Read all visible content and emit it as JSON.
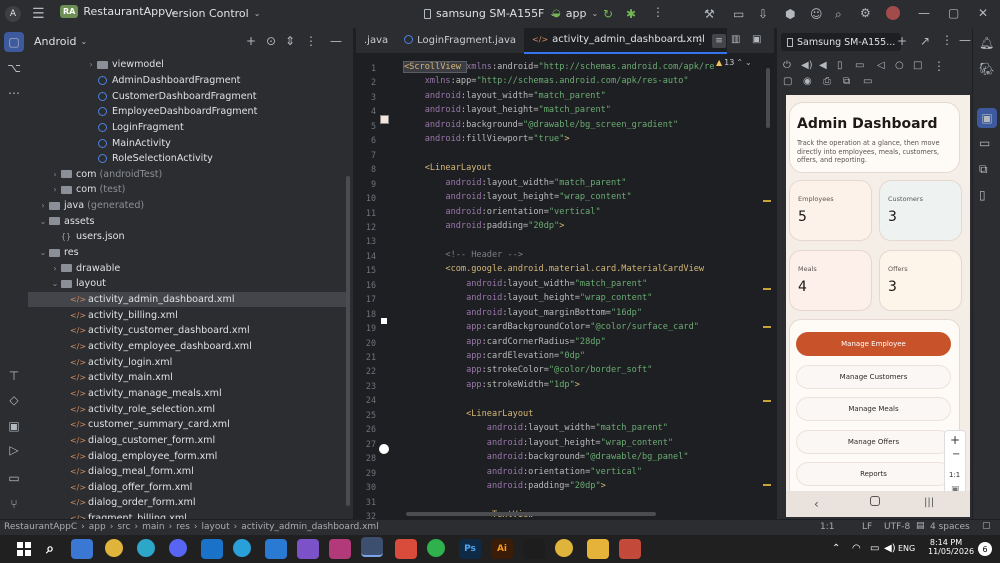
{
  "titlebar": {
    "app_badge": "RA",
    "app_name": "RestaurantApp",
    "vcs": "Version Control",
    "device": "samsung SM-A155F",
    "run_config": "app"
  },
  "project": {
    "view": "Android",
    "tree": [
      {
        "label": "viewmodel",
        "kind": "folder",
        "indent": 5,
        "arrow": "›"
      },
      {
        "label": "AdminDashboardFragment",
        "kind": "kt",
        "indent": 5
      },
      {
        "label": "CustomerDashboardFragment",
        "kind": "kt",
        "indent": 5
      },
      {
        "label": "EmployeeDashboardFragment",
        "kind": "kt",
        "indent": 5
      },
      {
        "label": "LoginFragment",
        "kind": "kt",
        "indent": 5
      },
      {
        "label": "MainActivity",
        "kind": "kt",
        "indent": 5
      },
      {
        "label": "RoleSelectionActivity",
        "kind": "kt",
        "indent": 5
      },
      {
        "label": "com",
        "suffix": "(androidTest)",
        "kind": "folder",
        "indent": 2,
        "arrow": "›"
      },
      {
        "label": "com",
        "suffix": "(test)",
        "kind": "folder",
        "indent": 2,
        "arrow": "›"
      },
      {
        "label": "java",
        "suffix": "(generated)",
        "kind": "folder",
        "indent": 1,
        "arrow": "›"
      },
      {
        "label": "assets",
        "kind": "folder",
        "indent": 1,
        "arrow": "⌄"
      },
      {
        "label": "users.json",
        "kind": "json",
        "indent": 2
      },
      {
        "label": "res",
        "kind": "folder",
        "indent": 1,
        "arrow": "⌄"
      },
      {
        "label": "drawable",
        "kind": "folder",
        "indent": 2,
        "arrow": "›"
      },
      {
        "label": "layout",
        "kind": "folder",
        "indent": 2,
        "arrow": "⌄"
      },
      {
        "label": "activity_admin_dashboard.xml",
        "kind": "xml",
        "indent": 3,
        "selected": true
      },
      {
        "label": "activity_billing.xml",
        "kind": "xml",
        "indent": 3
      },
      {
        "label": "activity_customer_dashboard.xml",
        "kind": "xml",
        "indent": 3
      },
      {
        "label": "activity_employee_dashboard.xml",
        "kind": "xml",
        "indent": 3
      },
      {
        "label": "activity_login.xml",
        "kind": "xml",
        "indent": 3
      },
      {
        "label": "activity_main.xml",
        "kind": "xml",
        "indent": 3
      },
      {
        "label": "activity_manage_meals.xml",
        "kind": "xml",
        "indent": 3
      },
      {
        "label": "activity_role_selection.xml",
        "kind": "xml",
        "indent": 3
      },
      {
        "label": "customer_summary_card.xml",
        "kind": "xml",
        "indent": 3
      },
      {
        "label": "dialog_customer_form.xml",
        "kind": "xml",
        "indent": 3
      },
      {
        "label": "dialog_employee_form.xml",
        "kind": "xml",
        "indent": 3
      },
      {
        "label": "dialog_meal_form.xml",
        "kind": "xml",
        "indent": 3
      },
      {
        "label": "dialog_offer_form.xml",
        "kind": "xml",
        "indent": 3
      },
      {
        "label": "dialog_order_form.xml",
        "kind": "xml",
        "indent": 3
      },
      {
        "label": "fragment_billing.xml",
        "kind": "xml",
        "indent": 3
      }
    ]
  },
  "editor": {
    "tabs": [
      {
        "label": ".java",
        "active": false
      },
      {
        "label": "LoginFragment.java",
        "active": false
      },
      {
        "label": "activity_admin_dashboard.xml",
        "active": true
      }
    ],
    "warning_count": "13",
    "lines": [
      {
        "n": "1",
        "parts": [
          [
            "tag",
            "<ScrollView "
          ],
          [
            "ns",
            "xmlns"
          ],
          [
            "attr",
            ":android="
          ],
          [
            "val",
            "\"http://schemas.android.com/apk/re"
          ]
        ]
      },
      {
        "n": "2",
        "parts": [
          [
            "ns",
            "    xmlns"
          ],
          [
            "attr",
            ":app="
          ],
          [
            "val",
            "\"http://schemas.android.com/apk/res-auto\""
          ]
        ]
      },
      {
        "n": "3",
        "parts": [
          [
            "ns",
            "    android"
          ],
          [
            "attr",
            ":layout_width="
          ],
          [
            "val",
            "\"match_parent\""
          ]
        ]
      },
      {
        "n": "4",
        "parts": [
          [
            "ns",
            "    android"
          ],
          [
            "attr",
            ":layout_height="
          ],
          [
            "val",
            "\"match_parent\""
          ]
        ]
      },
      {
        "n": "5",
        "parts": [
          [
            "ns",
            "    android"
          ],
          [
            "attr",
            ":background="
          ],
          [
            "val",
            "\"@drawable/bg_screen_gradient\""
          ]
        ]
      },
      {
        "n": "6",
        "parts": [
          [
            "ns",
            "    android"
          ],
          [
            "attr",
            ":fillViewport="
          ],
          [
            "val",
            "\"true\""
          ],
          [
            "tag",
            ">"
          ]
        ]
      },
      {
        "n": "7",
        "parts": []
      },
      {
        "n": "8",
        "parts": [
          [
            "tag",
            "    <LinearLayout"
          ]
        ]
      },
      {
        "n": "9",
        "parts": [
          [
            "ns",
            "        android"
          ],
          [
            "attr",
            ":layout_width="
          ],
          [
            "val",
            "\"match_parent\""
          ]
        ]
      },
      {
        "n": "10",
        "parts": [
          [
            "ns",
            "        android"
          ],
          [
            "attr",
            ":layout_height="
          ],
          [
            "val",
            "\"wrap_content\""
          ]
        ]
      },
      {
        "n": "11",
        "parts": [
          [
            "ns",
            "        android"
          ],
          [
            "attr",
            ":orientation="
          ],
          [
            "val",
            "\"vertical\""
          ]
        ]
      },
      {
        "n": "12",
        "parts": [
          [
            "ns",
            "        android"
          ],
          [
            "attr",
            ":padding="
          ],
          [
            "val",
            "\"20dp\""
          ],
          [
            "tag",
            ">"
          ]
        ]
      },
      {
        "n": "13",
        "parts": []
      },
      {
        "n": "14",
        "parts": [
          [
            "cm",
            "        <!-- Header -->"
          ]
        ]
      },
      {
        "n": "15",
        "parts": [
          [
            "tag",
            "        <com.google.android.material.card.MaterialCardView"
          ]
        ]
      },
      {
        "n": "16",
        "parts": [
          [
            "ns",
            "            android"
          ],
          [
            "attr",
            ":layout_width="
          ],
          [
            "val",
            "\"match_parent\""
          ]
        ]
      },
      {
        "n": "17",
        "parts": [
          [
            "ns",
            "            android"
          ],
          [
            "attr",
            ":layout_height="
          ],
          [
            "val",
            "\"wrap_content\""
          ]
        ]
      },
      {
        "n": "18",
        "parts": [
          [
            "ns",
            "            android"
          ],
          [
            "attr",
            ":layout_marginBottom="
          ],
          [
            "val",
            "\"16dp\""
          ]
        ]
      },
      {
        "n": "19",
        "parts": [
          [
            "ns",
            "            app"
          ],
          [
            "attr",
            ":cardBackgroundColor="
          ],
          [
            "val",
            "\"@color/surface_card\""
          ]
        ]
      },
      {
        "n": "20",
        "parts": [
          [
            "ns",
            "            app"
          ],
          [
            "attr",
            ":cardCornerRadius="
          ],
          [
            "val",
            "\"28dp\""
          ]
        ]
      },
      {
        "n": "21",
        "parts": [
          [
            "ns",
            "            app"
          ],
          [
            "attr",
            ":cardElevation="
          ],
          [
            "val",
            "\"0dp\""
          ]
        ]
      },
      {
        "n": "22",
        "parts": [
          [
            "ns",
            "            app"
          ],
          [
            "attr",
            ":strokeColor="
          ],
          [
            "val",
            "\"@color/border_soft\""
          ]
        ]
      },
      {
        "n": "23",
        "parts": [
          [
            "ns",
            "            app"
          ],
          [
            "attr",
            ":strokeWidth="
          ],
          [
            "val",
            "\"1dp\""
          ],
          [
            "tag",
            ">"
          ]
        ]
      },
      {
        "n": "24",
        "parts": []
      },
      {
        "n": "25",
        "parts": [
          [
            "tag",
            "            <LinearLayout"
          ]
        ]
      },
      {
        "n": "26",
        "parts": [
          [
            "ns",
            "                android"
          ],
          [
            "attr",
            ":layout_width="
          ],
          [
            "val",
            "\"match_parent\""
          ]
        ]
      },
      {
        "n": "27",
        "parts": [
          [
            "ns",
            "                android"
          ],
          [
            "attr",
            ":layout_height="
          ],
          [
            "val",
            "\"wrap_content\""
          ]
        ]
      },
      {
        "n": "28",
        "parts": [
          [
            "ns",
            "                android"
          ],
          [
            "attr",
            ":background="
          ],
          [
            "val",
            "\"@drawable/bg_panel\""
          ]
        ]
      },
      {
        "n": "29",
        "parts": [
          [
            "ns",
            "                android"
          ],
          [
            "attr",
            ":orientation="
          ],
          [
            "val",
            "\"vertical\""
          ]
        ]
      },
      {
        "n": "30",
        "parts": [
          [
            "ns",
            "                android"
          ],
          [
            "attr",
            ":padding="
          ],
          [
            "val",
            "\"20dp\""
          ],
          [
            "tag",
            ">"
          ]
        ]
      },
      {
        "n": "31",
        "parts": []
      },
      {
        "n": "32",
        "parts": [
          [
            "tag",
            "                <TextView"
          ]
        ]
      }
    ]
  },
  "device_panel": {
    "device_tab": "Samsung SM-A155...",
    "screen": {
      "title": "Admin Dashboard",
      "description": "Track the operation at a glance, then move directly into employees, meals, customers, offers, and reporting.",
      "stats": [
        {
          "label": "Employees",
          "value": "5"
        },
        {
          "label": "Customers",
          "value": "3"
        },
        {
          "label": "Meals",
          "value": "4"
        },
        {
          "label": "Offers",
          "value": "3"
        }
      ],
      "buttons": [
        {
          "label": "Manage Employee",
          "primary": true
        },
        {
          "label": "Manage Customers",
          "primary": false
        },
        {
          "label": "Manage Meals",
          "primary": false
        },
        {
          "label": "Manage Offers",
          "primary": false
        },
        {
          "label": "Reports",
          "primary": false
        }
      ],
      "zoom_label": "1:1"
    }
  },
  "statusbar": {
    "breadcrumb": [
      "RestaurantAppC",
      "app",
      "src",
      "main",
      "res",
      "layout",
      "activity_admin_dashboard.xml"
    ],
    "position": "1:1",
    "line_sep": "LF",
    "encoding": "UTF-8",
    "indent": "4 spaces"
  },
  "taskbar": {
    "lang": "ENG",
    "time": "8:14 PM",
    "date": "11/05/2026",
    "notif_count": "6"
  }
}
